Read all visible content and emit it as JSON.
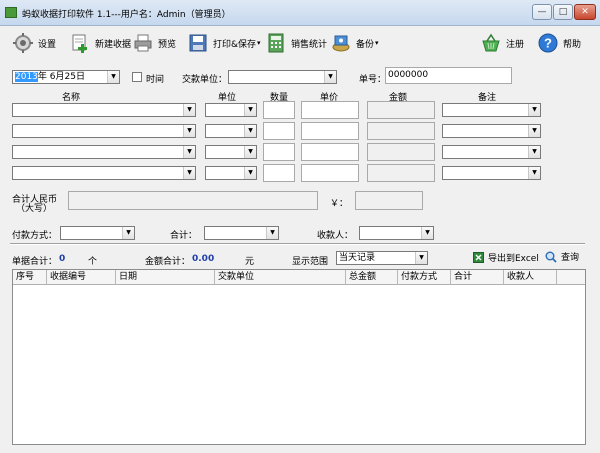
{
  "window": {
    "title": "蚂蚁收据打印软件 1.1---用户名：Admin（管理员）",
    "min": "—",
    "max": "□",
    "close": "✕"
  },
  "toolbar": {
    "settings": "设置",
    "new_receipt": "新建收据",
    "preview": "预览",
    "print_save": "打印&保存",
    "sales_stats": "销售统计",
    "backup": "备份",
    "register": "注册",
    "help": "帮助",
    "dropdown_arrow": "▾"
  },
  "form": {
    "date_year_selected": "2013",
    "date_rest": "年  6月25日",
    "time_label": "时间",
    "payer_label": "交款单位：",
    "number_label": "单号：",
    "number_value": "0000000",
    "columns": {
      "name": "名称",
      "unit": "单位",
      "qty": "数量",
      "price": "单价",
      "amount": "金额",
      "remark": "备注"
    },
    "rmb_label_1": "合计人民币",
    "rmb_label_2": "（大写）",
    "yen_label": "￥：",
    "payment_method_label": "付款方式：",
    "total_label": "合计：",
    "payee_label": "收款人："
  },
  "stats": {
    "receipt_total_label": "单据合计：",
    "receipt_total_value": "0",
    "receipt_unit": "个",
    "amount_total_label": "金额合计：",
    "amount_total_value": "0.00",
    "amount_unit": "元",
    "range_label": "显示范围",
    "range_value": "当天记录",
    "export_label": "导出到Excel",
    "query_label": "查询"
  },
  "grid": {
    "columns": [
      "序号",
      "收据编号",
      "日期",
      "交款单位",
      "总金额",
      "付款方式",
      "合计",
      "收款人"
    ]
  },
  "icon_names": [
    "gear-icon",
    "new-document-icon",
    "printer-icon",
    "print-save-icon",
    "calculator-icon",
    "backup-disk-icon",
    "basket-icon",
    "help-icon",
    "excel-icon",
    "magnifier-icon"
  ],
  "colors": {
    "accent_value": "#1f3fa8",
    "selection": "#3399ff"
  }
}
